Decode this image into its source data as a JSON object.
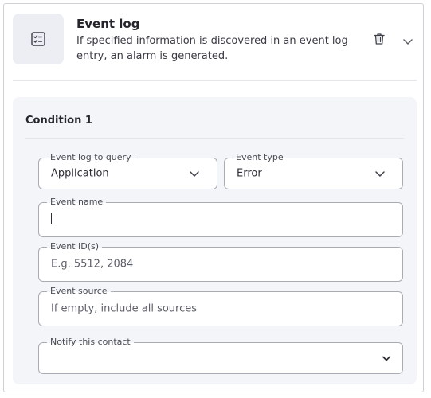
{
  "card": {
    "title": "Event log",
    "description": "If specified information is discovered in an event log entry, an alarm is generated.",
    "header_icon": "checklist-icon",
    "delete_icon": "trash-icon",
    "collapse_icon": "chevron-down-icon"
  },
  "condition": {
    "title": "Condition 1",
    "fields": {
      "event_log_to_query": {
        "label": "Event log to query",
        "value": "Application"
      },
      "event_type": {
        "label": "Event type",
        "value": "Error"
      },
      "event_name": {
        "label": "Event name",
        "value": ""
      },
      "event_ids": {
        "label": "Event ID(s)",
        "placeholder": "E.g. 5512, 2084"
      },
      "event_source": {
        "label": "Event source",
        "placeholder": "If empty, include all sources"
      },
      "notify_contact": {
        "label": "Notify this contact",
        "value": ""
      }
    }
  },
  "colors": {
    "panel_bg": "#f4f5f8",
    "icon_tile_bg": "#eceef3",
    "field_border": "#a9abb5",
    "text": "#2b2b33"
  }
}
